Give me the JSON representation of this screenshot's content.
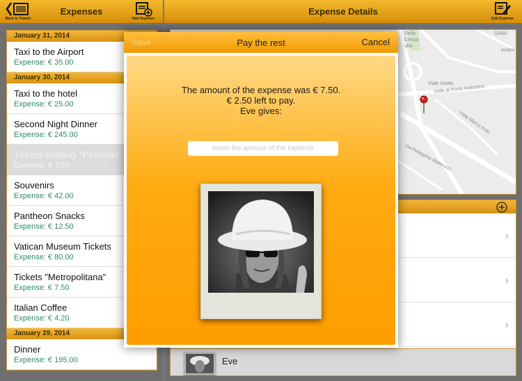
{
  "left_bar": {
    "title": "Expenses",
    "back_caption": "Back to Travels",
    "new_caption": "New Expense"
  },
  "right_bar": {
    "title": "Expense Details",
    "edit_caption": "Edit Expense"
  },
  "expenses": [
    {
      "date": "January 31, 2014",
      "items": [
        {
          "name": "Taxi to the Airport",
          "amount": "Expense: € 35.00"
        }
      ]
    },
    {
      "date": "January 30, 2014",
      "items": [
        {
          "name": "Taxi to the hotel",
          "amount": "Expense: € 25.00"
        },
        {
          "name": "Second Night Dinner",
          "amount": "Expense: € 245.00"
        },
        {
          "name": "Tickets Subway \"Piramide\"",
          "amount": "Expense: € 7.50",
          "selected": true
        },
        {
          "name": "Souvenirs",
          "amount": "Expense: € 42.00"
        },
        {
          "name": "Pantheon Snacks",
          "amount": "Expense: € 12.50"
        },
        {
          "name": "Vatican Museum Tickets",
          "amount": "Expense: € 80.00"
        },
        {
          "name": "Tickets \"Metropolitana\"",
          "amount": "Expense: € 7.50"
        },
        {
          "name": "Italian Coffee",
          "amount": "Expense: € 4.20"
        }
      ]
    },
    {
      "date": "January 29, 2014",
      "items": [
        {
          "name": "Dinner",
          "amount": "Expense: € 195.00"
        }
      ]
    }
  ],
  "map": {
    "labels": [
      "Della",
      "Cenza",
      "ulla",
      "SABA",
      "Viale Giotto",
      "Viale di Porta Ardeatina",
      "Viale Marco Polo",
      "Via Pellegrino Matteucci",
      "embre"
    ]
  },
  "participant": {
    "name": "Eve"
  },
  "modal": {
    "title": "Pay the rest",
    "save_label": "Save",
    "cancel_label": "Cancel",
    "line1": "The amount of the expense was € 7.50.",
    "line2": "€ 2.50 left to pay.",
    "line3": "Eve gives:",
    "input_placeholder": "Insert the amount of the expense"
  },
  "colors": {
    "accent": "#f39a00",
    "amount_text": "#2f8a62"
  }
}
